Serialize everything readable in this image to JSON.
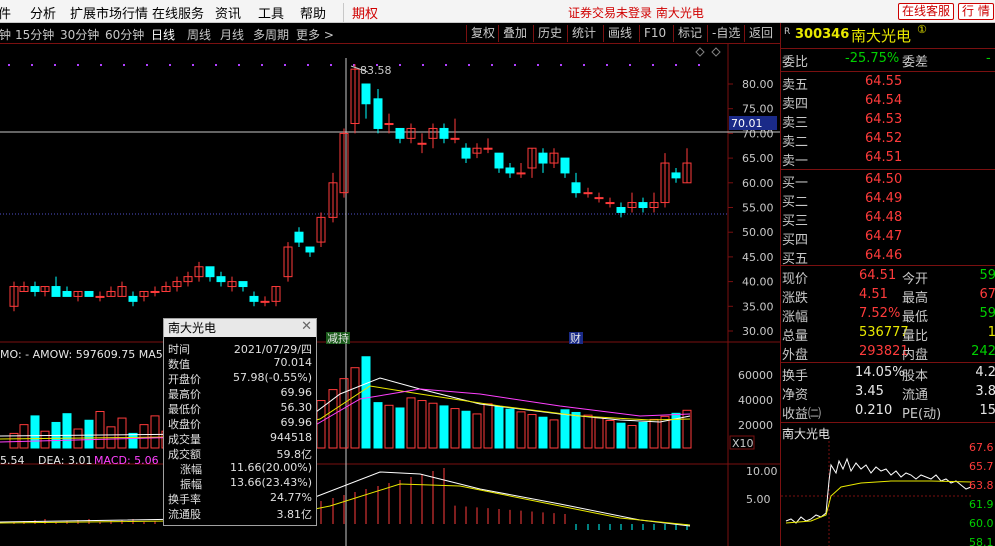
{
  "menu": {
    "items": [
      "件",
      "分析",
      "扩展市场行情",
      "在线服务",
      "资讯",
      "工具",
      "帮助",
      "期权"
    ],
    "notice": "证券交易未登录  南大光电",
    "service_btn": "在线客服",
    "right_btn": "行 情"
  },
  "toolbar": {
    "periods": [
      "钟",
      "15分钟",
      "30分钟",
      "60分钟",
      "日线",
      "周线",
      "月线",
      "多周期",
      "更多 >"
    ],
    "active_period": "日线",
    "buttons": [
      "复权",
      "叠加",
      "历史",
      "统计",
      "画线",
      "F10",
      "标记",
      "-自选",
      "返回"
    ]
  },
  "chart": {
    "high_marker": "83.58",
    "crosshair_price": "70.01",
    "price_ticks": [
      "80.00",
      "75.00",
      "70.00",
      "65.00",
      "60.00",
      "55.00",
      "50.00",
      "45.00",
      "40.00",
      "35.00",
      "30.00"
    ],
    "event_labels": [
      "减持",
      "财"
    ],
    "volume_header": "MO: -  AMOW: 597609.75  MA5",
    "volume_ticks": [
      "60000",
      "40000",
      "20000"
    ],
    "volume_unit": "X10",
    "macd_header": {
      "dif": "5.54",
      "dea": "DEA: 3.01",
      "macd": "MACD: 5.06"
    },
    "macd_ticks": [
      "10.00",
      "5.00"
    ],
    "colors": {
      "up": "#ff3b3b",
      "down": "#00ffff",
      "ma_white": "#ffffff",
      "ma_yellow": "#e8e800",
      "ma_magenta": "#ff40ff"
    }
  },
  "popup": {
    "title": "南大光电",
    "rows": [
      {
        "k": "时间",
        "v": "2021/07/29/四",
        "c": "white"
      },
      {
        "k": "数值",
        "v": "70.014",
        "c": "white"
      },
      {
        "k": "开盘价",
        "v": "57.98(-0.55%)",
        "c": "green"
      },
      {
        "k": "最高价",
        "v": "69.96",
        "c": "red"
      },
      {
        "k": "最低价",
        "v": "56.30",
        "c": "green"
      },
      {
        "k": "收盘价",
        "v": "69.96",
        "c": "red"
      },
      {
        "k": "成交量",
        "v": "944518",
        "c": "yellow"
      },
      {
        "k": "成交额",
        "v": "59.8亿",
        "c": "white"
      },
      {
        "k": "涨幅",
        "v": "11.66(20.00%)",
        "c": "red"
      },
      {
        "k": "振幅",
        "v": "13.66(23.43%)",
        "c": "white"
      },
      {
        "k": "换手率",
        "v": "24.77%",
        "c": "white"
      },
      {
        "k": "流通股",
        "v": "3.81亿",
        "c": "white"
      }
    ]
  },
  "quote": {
    "code": "300346",
    "name": "南大光电",
    "weibi": {
      "label": "委比",
      "value": "-25.75%",
      "label2": "委差"
    },
    "asks": [
      {
        "label": "卖五",
        "price": "64.55"
      },
      {
        "label": "卖四",
        "price": "64.54"
      },
      {
        "label": "卖三",
        "price": "64.53"
      },
      {
        "label": "卖二",
        "price": "64.52"
      },
      {
        "label": "卖一",
        "price": "64.51"
      }
    ],
    "bids": [
      {
        "label": "买一",
        "price": "64.50"
      },
      {
        "label": "买二",
        "price": "64.49"
      },
      {
        "label": "买三",
        "price": "64.48"
      },
      {
        "label": "买四",
        "price": "64.47"
      },
      {
        "label": "买五",
        "price": "64.46"
      }
    ],
    "stats": [
      {
        "k1": "现价",
        "v1": "64.51",
        "c1": "red",
        "k2": "今开",
        "v2": "59",
        "c2": "green"
      },
      {
        "k1": "涨跌",
        "v1": "4.51",
        "c1": "red",
        "k2": "最高",
        "v2": "67",
        "c2": "red"
      },
      {
        "k1": "涨幅",
        "v1": "7.52%",
        "c1": "red",
        "k2": "最低",
        "v2": "59",
        "c2": "green"
      },
      {
        "k1": "总量",
        "v1": "536777",
        "c1": "yellow",
        "k2": "量比",
        "v2": "1",
        "c2": "yellow"
      },
      {
        "k1": "外盘",
        "v1": "293821",
        "c1": "red",
        "k2": "内盘",
        "v2": "242",
        "c2": "green"
      }
    ],
    "stats2": [
      {
        "k1": "换手",
        "v1": "14.05%",
        "k2": "股本",
        "v2": "4.2"
      },
      {
        "k1": "净资",
        "v1": "3.45",
        "k2": "流通",
        "v2": "3.8"
      },
      {
        "k1": "收益㈡",
        "v1": "0.210",
        "k2": "PE(动)",
        "v2": "15"
      }
    ],
    "mini_title": "南大光电",
    "mini_ticks": [
      "67.6",
      "65.7",
      "63.8",
      "61.9",
      "60.0",
      "58.1"
    ]
  }
}
